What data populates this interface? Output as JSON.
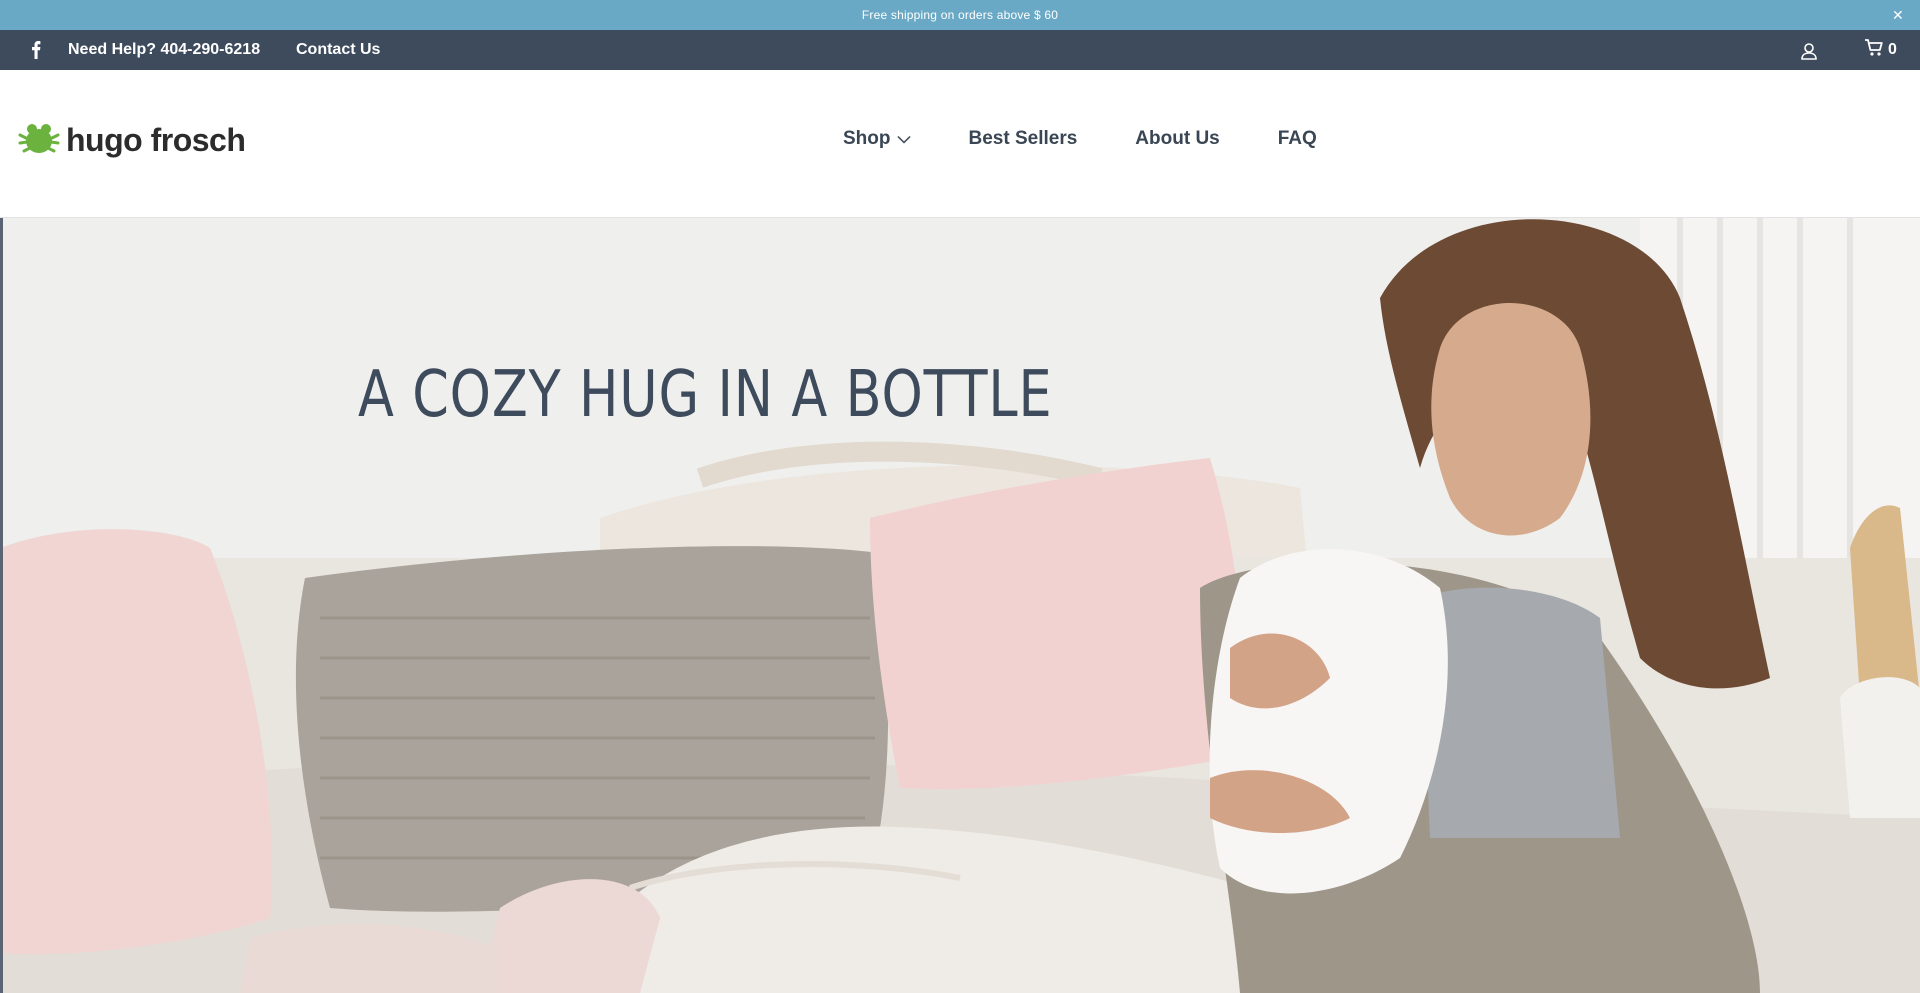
{
  "announcement": {
    "text": "Free shipping on orders above $ 60",
    "close_glyph": "✕"
  },
  "utility_bar": {
    "facebook_icon": "facebook-icon",
    "help_text": "Need Help? 404-290-6218",
    "contact_label": "Contact Us",
    "account_icon": "user-icon",
    "cart_icon": "cart-icon",
    "cart_count": "0"
  },
  "header": {
    "logo_text": "hugo frosch",
    "nav": {
      "shop": "Shop",
      "best_sellers": "Best Sellers",
      "about": "About Us",
      "faq": "FAQ"
    }
  },
  "hero": {
    "headline": "A COZY HUG IN A BOTTLE"
  },
  "colors": {
    "announcement_bg": "#6aa9c5",
    "utility_bg": "#3d4b5c",
    "nav_text": "#3a4654",
    "brand_green": "#6bb33e"
  }
}
